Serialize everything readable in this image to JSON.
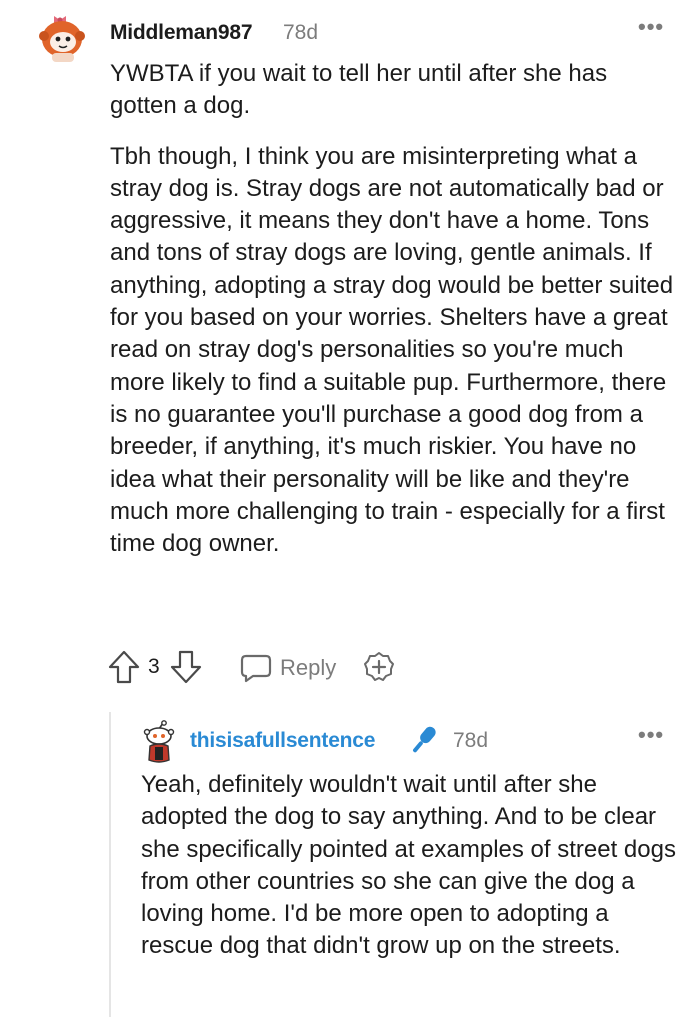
{
  "comment1": {
    "username": "Middleman987",
    "age": "78d",
    "more": "•••",
    "paragraphs": [
      "YWBTA if you wait to tell her until after she has gotten a dog.",
      "Tbh though, I think you are misinterpreting what a stray dog is. Stray dogs are not automatically bad or aggressive, it means they don't have a home. Tons and tons of stray dogs are loving, gentle animals. If anything, adopting a stray dog would be better suited for you based on your worries. Shelters have a great read on stray dog's personalities so you're much more likely to find a suitable pup. Furthermore, there is no guarantee you'll purchase a good dog from a breeder, if anything, it's much riskier. You have no idea what their personality will be like and they're much more challenging to train - especially for a first time dog owner."
    ],
    "votes": "3",
    "reply_label": "Reply"
  },
  "comment2": {
    "username": "thisisafullsentence",
    "age": "78d",
    "more": "•••",
    "text": "Yeah, definitely wouldn't wait until after she adopted the dog to say anything. And to be clear she specifically pointed at examples of street dogs from other countries so she can give the dog a loving home. I'd be more open to adopting a rescue dog that didn't grow up on the streets."
  },
  "icons": {
    "upvote": "upvote-arrow-icon",
    "downvote": "downvote-arrow-icon",
    "reply": "speech-bubble-icon",
    "award": "award-plus-icon",
    "mic": "microphone-icon"
  },
  "colors": {
    "text": "#1c1c1c",
    "muted": "#7c7c7c",
    "op_username": "#2a8ad4",
    "mic_blue": "#2a8ad4",
    "avatar_orange": "#e0642a"
  }
}
